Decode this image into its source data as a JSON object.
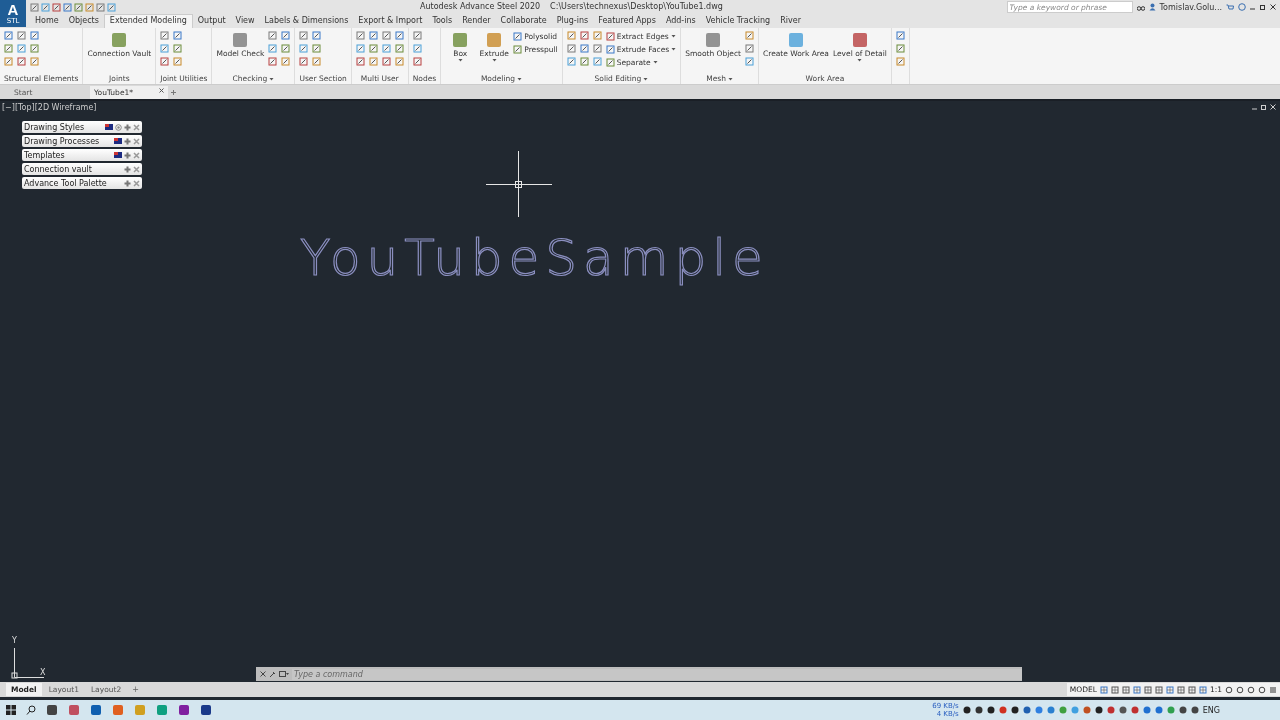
{
  "app_button": {
    "letter": "A",
    "sub": "STL"
  },
  "title_bar": {
    "app": "Autodesk Advance Steel 2020",
    "file": "C:\\Users\\technexus\\Desktop\\YouTube1.dwg",
    "search": {
      "placeholder": "Type a keyword or phrase"
    },
    "user": "Tomislav.Golu..."
  },
  "ribbon_tabs": [
    {
      "label": "Home",
      "selected": false
    },
    {
      "label": "Objects",
      "selected": false
    },
    {
      "label": "Extended Modeling",
      "selected": true
    },
    {
      "label": "Output",
      "selected": false
    },
    {
      "label": "View",
      "selected": false
    },
    {
      "label": "Labels & Dimensions",
      "selected": false
    },
    {
      "label": "Export & Import",
      "selected": false
    },
    {
      "label": "Tools",
      "selected": false
    },
    {
      "label": "Render",
      "selected": false
    },
    {
      "label": "Collaborate",
      "selected": false
    },
    {
      "label": "Plug-ins",
      "selected": false
    },
    {
      "label": "Featured Apps",
      "selected": false
    },
    {
      "label": "Add-ins",
      "selected": false
    },
    {
      "label": "Vehicle Tracking",
      "selected": false
    },
    {
      "label": "River",
      "selected": false
    }
  ],
  "ribbon_panels": [
    {
      "label": "Structural Elements",
      "dropdown": false
    },
    {
      "label": "Joints",
      "dropdown": false,
      "tools": [
        {
          "label": "Connection Vault",
          "kind": "large",
          "dropdown": false
        }
      ]
    },
    {
      "label": "Joint Utilities",
      "dropdown": false
    },
    {
      "label": "Checking",
      "dropdown": true,
      "tools": [
        {
          "label": "Model Check",
          "kind": "large",
          "dropdown": false
        }
      ]
    },
    {
      "label": "User Section",
      "dropdown": false
    },
    {
      "label": "Multi User",
      "dropdown": false
    },
    {
      "label": "Nodes",
      "dropdown": false
    },
    {
      "label": "Modeling",
      "dropdown": true,
      "tools": [
        {
          "label": "Box",
          "kind": "large",
          "dropdown": true
        },
        {
          "label": "Extrude",
          "kind": "large",
          "dropdown": true
        },
        {
          "label": "Polysolid",
          "kind": "small",
          "dropdown": false
        },
        {
          "label": "Presspull",
          "kind": "small",
          "dropdown": false
        }
      ]
    },
    {
      "label": "Solid Editing",
      "dropdown": true,
      "tools": [
        {
          "label": "Extract Edges",
          "kind": "small",
          "dropdown": true
        },
        {
          "label": "Extrude Faces",
          "kind": "small",
          "dropdown": true
        },
        {
          "label": "Separate",
          "kind": "small",
          "dropdown": true
        }
      ]
    },
    {
      "label": "Mesh",
      "dropdown": true,
      "tools": [
        {
          "label": "Smooth Object",
          "kind": "large",
          "dropdown": false
        }
      ]
    },
    {
      "label": "Work Area",
      "dropdown": false,
      "tools": [
        {
          "label": "Create Work Area",
          "kind": "large",
          "dropdown": false
        },
        {
          "label": "Level of Detail",
          "kind": "large",
          "dropdown": true
        }
      ]
    }
  ],
  "doc_tabs": [
    {
      "label": "Start",
      "selected": false
    },
    {
      "label": "YouTube1*",
      "selected": true
    }
  ],
  "viewport_label": "[−][Top][2D Wireframe]",
  "palettes": [
    {
      "label": "Drawing Styles",
      "kind": "styles"
    },
    {
      "label": "Drawing Processes",
      "kind": "flag"
    },
    {
      "label": "Templates",
      "kind": "flag"
    },
    {
      "label": "Connection vault",
      "kind": "plain"
    },
    {
      "label": "Advance Tool Palette",
      "kind": "plain"
    }
  ],
  "drawing_text": "YouTubeSample",
  "ucs": {
    "y": "Y",
    "x": "X"
  },
  "command_line": {
    "placeholder": "Type a command"
  },
  "layout_tabs": [
    {
      "label": "Model",
      "selected": true
    },
    {
      "label": "Layout1",
      "selected": false
    },
    {
      "label": "Layout2",
      "selected": false
    }
  ],
  "layout_add": "+",
  "status_bar": {
    "space": "MODEL",
    "scale": "1:1"
  },
  "taskbar": {
    "net_down": "69 KB/s",
    "net_up": "4 KB/s",
    "language": "ENG"
  }
}
